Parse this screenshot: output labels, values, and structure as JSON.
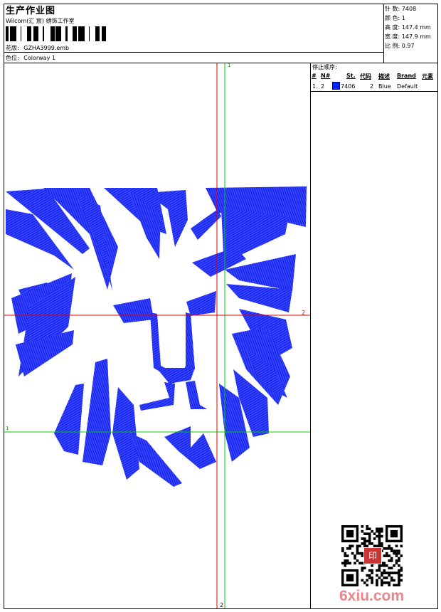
{
  "header": {
    "title": "生产作业图",
    "studio": "Wilcom(汇 宸) 绣饰工作室",
    "design_label": "花版:",
    "design_value": "GZHA3999.emb",
    "colorway_label": "色位:",
    "colorway_value": "Colorway 1"
  },
  "stats": [
    {
      "label": "针 数:",
      "value": "7408"
    },
    {
      "label": "颜 色:",
      "value": "1"
    },
    {
      "label": "高 度:",
      "value": "147.4 mm"
    },
    {
      "label": "宽 度:",
      "value": "147.9 mm"
    },
    {
      "label": "比 例:",
      "value": "0.97"
    }
  ],
  "stop_sequence": {
    "title": "停止顺序:",
    "columns": [
      "#",
      "N#",
      "St.",
      "代码",
      "描述",
      "Brand",
      "元素"
    ],
    "rows": [
      {
        "index": "1.",
        "needle": "2",
        "code": "7406",
        "stitches": "2",
        "desc": "Blue",
        "brand": "Default",
        "swatch_color": "#0022ff"
      }
    ]
  },
  "guides": {
    "green_vertical": "1",
    "red_horizontal": "2",
    "green_horizontal": "1",
    "red_vertical": "2"
  },
  "design_color": "#1a1aff",
  "watermark": "6xiu.com",
  "qr_badge": "印"
}
